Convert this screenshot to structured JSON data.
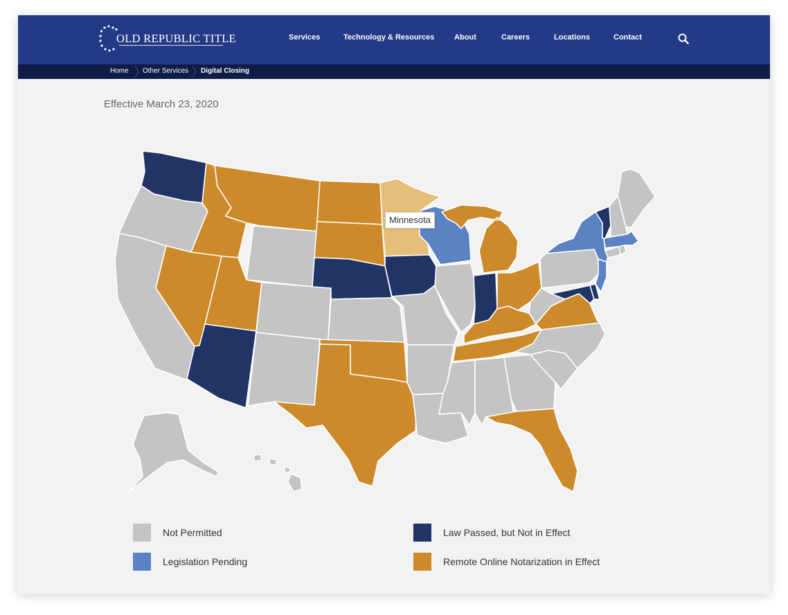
{
  "brand": {
    "name": "OLD REPUBLIC TITLE"
  },
  "nav": {
    "items": [
      {
        "label": "Services"
      },
      {
        "label": "Technology & Resources"
      },
      {
        "label": "About"
      },
      {
        "label": "Careers"
      },
      {
        "label": "Locations"
      },
      {
        "label": "Contact"
      }
    ],
    "search_icon": "search-icon"
  },
  "breadcrumb": [
    {
      "label": "Home"
    },
    {
      "label": "Other Services"
    },
    {
      "label": "Digital Closing"
    }
  ],
  "effective_date": "Effective March 23, 2020",
  "tooltip": "Minnesota",
  "colors": {
    "header": "#243a86",
    "breadcrumb_bar": "#0f1c45",
    "not_permitted": "#c4c4c4",
    "legislation_pending": "#5b82c3",
    "law_passed_not_in_effect": "#203565",
    "ron_in_effect": "#cc8a2a",
    "hover": "#e5be79"
  },
  "legend": [
    {
      "key": "not_permitted",
      "label": "Not Permitted"
    },
    {
      "key": "law_passed_not_in_effect",
      "label": "Law Passed, but Not in Effect"
    },
    {
      "key": "legislation_pending",
      "label": "Legislation Pending"
    },
    {
      "key": "ron_in_effect",
      "label": "Remote Online Notarization in Effect"
    }
  ],
  "states": {
    "WA": "law_passed_not_in_effect",
    "OR": "not_permitted",
    "CA": "not_permitted",
    "ID": "ron_in_effect",
    "NV": "ron_in_effect",
    "MT": "ron_in_effect",
    "WY": "not_permitted",
    "UT": "ron_in_effect",
    "AZ": "law_passed_not_in_effect",
    "CO": "not_permitted",
    "NM": "not_permitted",
    "ND": "ron_in_effect",
    "SD": "ron_in_effect",
    "NE": "law_passed_not_in_effect",
    "KS": "not_permitted",
    "OK": "ron_in_effect",
    "TX": "ron_in_effect",
    "MN": "hover",
    "IA": "law_passed_not_in_effect",
    "MO": "not_permitted",
    "AR": "not_permitted",
    "LA": "not_permitted",
    "WI": "legislation_pending",
    "IL": "not_permitted",
    "MI": "ron_in_effect",
    "IN": "law_passed_not_in_effect",
    "OH": "ron_in_effect",
    "KY": "ron_in_effect",
    "TN": "ron_in_effect",
    "MS": "not_permitted",
    "AL": "not_permitted",
    "GA": "not_permitted",
    "FL": "ron_in_effect",
    "SC": "not_permitted",
    "NC": "not_permitted",
    "VA": "ron_in_effect",
    "WV": "not_permitted",
    "MD": "law_passed_not_in_effect",
    "DE": "law_passed_not_in_effect",
    "PA": "not_permitted",
    "NJ": "legislation_pending",
    "NY": "legislation_pending",
    "CT": "not_permitted",
    "RI": "not_permitted",
    "MA": "legislation_pending",
    "VT": "law_passed_not_in_effect",
    "NH": "not_permitted",
    "ME": "not_permitted",
    "AK": "not_permitted",
    "HI": "not_permitted"
  }
}
